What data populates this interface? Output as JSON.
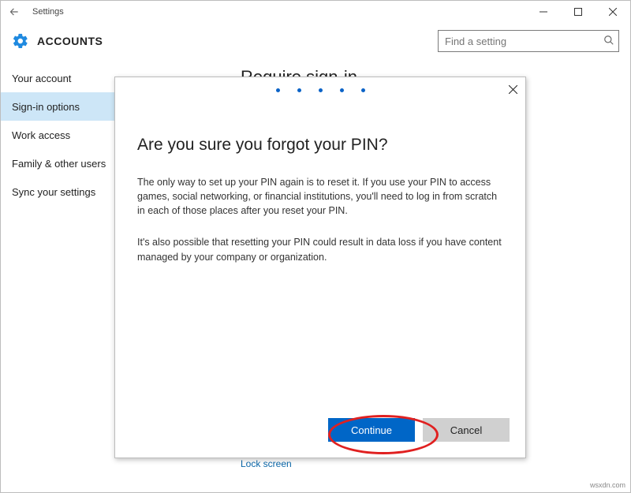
{
  "titlebar": {
    "title": "Settings"
  },
  "header": {
    "accounts": "ACCOUNTS"
  },
  "search": {
    "placeholder": "Find a setting"
  },
  "sidebar": {
    "items": [
      {
        "label": "Your account"
      },
      {
        "label": "Sign-in options"
      },
      {
        "label": "Work access"
      },
      {
        "label": "Family & other users"
      },
      {
        "label": "Sync your settings"
      }
    ]
  },
  "content": {
    "section_title": "Require sign-in",
    "lock_link": "Lock screen"
  },
  "dialog": {
    "title": "Are you sure you forgot your PIN?",
    "para1": "The only way to set up your PIN again is to reset it. If you use your PIN to access games, social networking, or financial institutions, you'll need to log in from scratch in each of those places after you reset your PIN.",
    "para2": "It's also possible that resetting your PIN could result in data loss if you have content managed by your company or organization.",
    "continue": "Continue",
    "cancel": "Cancel"
  },
  "watermark": "wsxdn.com"
}
